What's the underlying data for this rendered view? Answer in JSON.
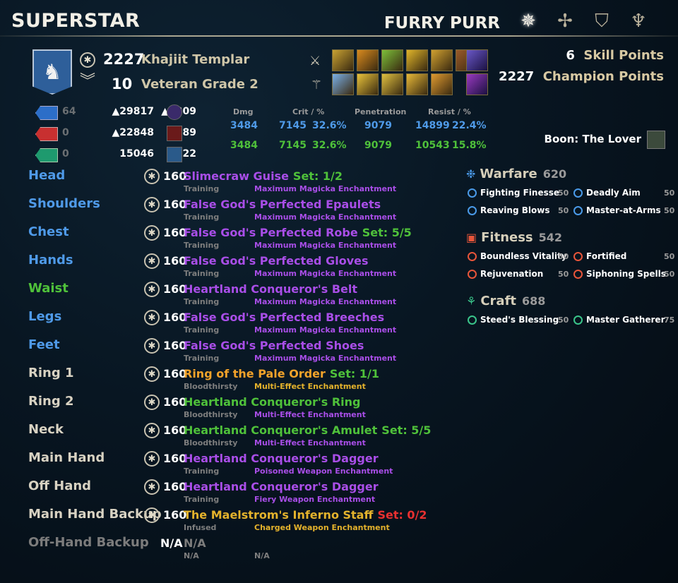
{
  "header": {
    "title": "SUPERSTAR",
    "character_name": "FURRY PURR",
    "tabs": [
      {
        "icon": "star-compass-icon",
        "active": true
      },
      {
        "icon": "crossed-arrows-icon",
        "active": false
      },
      {
        "icon": "shield-down-icon",
        "active": false
      },
      {
        "icon": "guild-crest-icon",
        "active": false
      }
    ]
  },
  "profile": {
    "level_value": "2227",
    "race_class": "Khajiit Templar",
    "vet_value": "10",
    "vet_label": "Veteran Grade 2"
  },
  "points": {
    "skill_value": "6",
    "skill_label": "Skill Points",
    "champion_value": "2227",
    "champion_label": "Champion Points"
  },
  "resources": [
    {
      "color": "#2c6ec8",
      "dim": "64",
      "max": "▲29817",
      "regen": "▲1309"
    },
    {
      "color": "#c83030",
      "dim": "0",
      "max": "▲22848",
      "regen": "489"
    },
    {
      "color": "#1e9a6e",
      "dim": "0",
      "max": "15046",
      "regen": "722"
    }
  ],
  "stats": {
    "headers": [
      "Dmg",
      "Crit / %",
      "Penetration",
      "Resist / %"
    ],
    "blue": [
      "3484",
      "7145",
      "32.6%",
      "9079",
      "14899",
      "22.4%"
    ],
    "green": [
      "3484",
      "7145",
      "32.6%",
      "9079",
      "10543",
      "15.8%"
    ]
  },
  "boon": "Boon: The Lover",
  "gear": [
    {
      "slot": "Head",
      "slot_color": "blue",
      "lvl": "160",
      "name": "Slimecraw Guise",
      "name_color": "purple",
      "set": "Set: 1/2",
      "set_color": "green",
      "trait": "Training",
      "ench": "Maximum Magicka Enchantment",
      "ench_color": "purple"
    },
    {
      "slot": "Shoulders",
      "slot_color": "blue",
      "lvl": "160",
      "name": "False God's Perfected Epaulets",
      "name_color": "purple",
      "set": "",
      "set_color": "green",
      "trait": "Training",
      "ench": "Maximum Magicka Enchantment",
      "ench_color": "purple"
    },
    {
      "slot": "Chest",
      "slot_color": "blue",
      "lvl": "160",
      "name": "False God's Perfected Robe",
      "name_color": "purple",
      "set": "Set: 5/5",
      "set_color": "green",
      "trait": "Training",
      "ench": "Maximum Magicka Enchantment",
      "ench_color": "purple"
    },
    {
      "slot": "Hands",
      "slot_color": "blue",
      "lvl": "160",
      "name": "False God's Perfected Gloves",
      "name_color": "purple",
      "set": "",
      "set_color": "green",
      "trait": "Training",
      "ench": "Maximum Magicka Enchantment",
      "ench_color": "purple"
    },
    {
      "slot": "Waist",
      "slot_color": "green",
      "lvl": "160",
      "name": "Heartland Conqueror's Belt",
      "name_color": "purple",
      "set": "",
      "set_color": "green",
      "trait": "Training",
      "ench": "Maximum Magicka Enchantment",
      "ench_color": "purple"
    },
    {
      "slot": "Legs",
      "slot_color": "blue",
      "lvl": "160",
      "name": "False God's Perfected Breeches",
      "name_color": "purple",
      "set": "",
      "set_color": "green",
      "trait": "Training",
      "ench": "Maximum Magicka Enchantment",
      "ench_color": "purple"
    },
    {
      "slot": "Feet",
      "slot_color": "blue",
      "lvl": "160",
      "name": "False God's Perfected Shoes",
      "name_color": "purple",
      "set": "",
      "set_color": "green",
      "trait": "Training",
      "ench": "Maximum Magicka Enchantment",
      "ench_color": "purple"
    },
    {
      "slot": "Ring 1",
      "slot_color": "white",
      "lvl": "160",
      "name": "Ring of the Pale Order",
      "name_color": "orange",
      "set": "Set: 1/1",
      "set_color": "green",
      "trait": "Bloodthirsty",
      "ench": "Multi-Effect Enchantment",
      "ench_color": "gold2"
    },
    {
      "slot": "Ring 2",
      "slot_color": "white",
      "lvl": "160",
      "name": "Heartland Conqueror's Ring",
      "name_color": "green",
      "set": "",
      "set_color": "green",
      "trait": "Bloodthirsty",
      "ench": "Multi-Effect Enchantment",
      "ench_color": "purple"
    },
    {
      "slot": "Neck",
      "slot_color": "white",
      "lvl": "160",
      "name": "Heartland Conqueror's Amulet",
      "name_color": "green",
      "set": "Set: 5/5",
      "set_color": "green",
      "trait": "Bloodthirsty",
      "ench": "Multi-Effect Enchantment",
      "ench_color": "purple"
    },
    {
      "slot": "Main Hand",
      "slot_color": "white",
      "lvl": "160",
      "name": "Heartland Conqueror's Dagger",
      "name_color": "purple",
      "set": "",
      "set_color": "green",
      "trait": "Training",
      "ench": "Poisoned Weapon Enchantment",
      "ench_color": "purple"
    },
    {
      "slot": "Off Hand",
      "slot_color": "white",
      "lvl": "160",
      "name": "Heartland Conqueror's Dagger",
      "name_color": "purple",
      "set": "",
      "set_color": "green",
      "trait": "Training",
      "ench": "Fiery Weapon Enchantment",
      "ench_color": "purple"
    },
    {
      "slot": "Main Hand Backup",
      "slot_color": "white",
      "lvl": "160",
      "name": "The Maelstrom's Inferno Staff",
      "name_color": "gold2",
      "set": "Set: 0/2",
      "set_color": "red",
      "trait": "Infused",
      "ench": "Charged Weapon Enchantment",
      "ench_color": "gold2"
    }
  ],
  "offhand_backup": {
    "slot": "Off-Hand Backup",
    "lvl": "N/A",
    "name": "N/A",
    "trait": "N/A",
    "ench": "N/A"
  },
  "champion": [
    {
      "name": "Warfare",
      "value": "620",
      "color": "#4a9ae8",
      "icon": "snowflake-star-icon",
      "items": [
        {
          "name": "Fighting Finesse",
          "val": "50"
        },
        {
          "name": "Deadly Aim",
          "val": "50"
        },
        {
          "name": "Reaving Blows",
          "val": "50"
        },
        {
          "name": "Master-at-Arms",
          "val": "50"
        }
      ]
    },
    {
      "name": "Fitness",
      "value": "542",
      "color": "#e8553a",
      "icon": "fist-rune-icon",
      "items": [
        {
          "name": "Boundless Vitality",
          "val": "50"
        },
        {
          "name": "Fortified",
          "val": "50"
        },
        {
          "name": "Rejuvenation",
          "val": "50"
        },
        {
          "name": "Siphoning Spells",
          "val": "50"
        }
      ]
    },
    {
      "name": "Craft",
      "value": "688",
      "color": "#3ac48a",
      "icon": "tree-rune-icon",
      "items": [
        {
          "name": "Steed's Blessing",
          "val": "50"
        },
        {
          "name": "Master Gatherer",
          "val": "75"
        }
      ]
    }
  ],
  "skill_bars": {
    "front": [
      "#c9a233",
      "#d98a1e",
      "#7cbf3a",
      "#e0b52a",
      "#d0a030",
      "#9a5a2a"
    ],
    "front_ult": "#6a58c8",
    "back": [
      "#7ab0e8",
      "#e8c23a",
      "#e0c040",
      "#e6b838",
      "#e09a30"
    ],
    "back_ult": "#9a3ac0"
  }
}
